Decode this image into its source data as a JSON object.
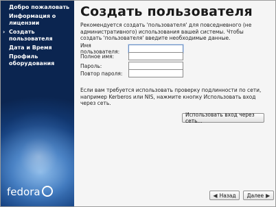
{
  "sidebar": {
    "steps": [
      {
        "label": "Добро пожаловать"
      },
      {
        "label": "Информация о лицензии"
      },
      {
        "label": "Создать пользователя",
        "current": true
      },
      {
        "label": "Дата и Время"
      },
      {
        "label": "Профиль оборудования"
      }
    ],
    "current_marker": "›",
    "logo": "fedora"
  },
  "main": {
    "title": "Создать пользователя",
    "intro": "Рекомендуется создать 'пользователя' для повседневного (не административного) использования вашей системы. Чтобы создать 'пользователя' введите необходимые данные.",
    "fields": {
      "username": {
        "label": "Имя пользователя:",
        "value": ""
      },
      "fullname": {
        "label": "Полное имя:",
        "value": ""
      },
      "password": {
        "label": "Пароль:",
        "value": ""
      },
      "confirm": {
        "label": "Повтор пароля:",
        "value": ""
      }
    },
    "auth_text": "Если вам требуется использовать проверку подлинности по сети, например Kerberos или NIS, нажмите кнопку Использовать вход через сеть.",
    "network_login_button": "Использовать вход через сеть..."
  },
  "footer": {
    "back_label": "Назад",
    "forward_label": "Далее"
  },
  "icons": {
    "back": "arrow-left-icon",
    "forward": "arrow-right-icon"
  }
}
